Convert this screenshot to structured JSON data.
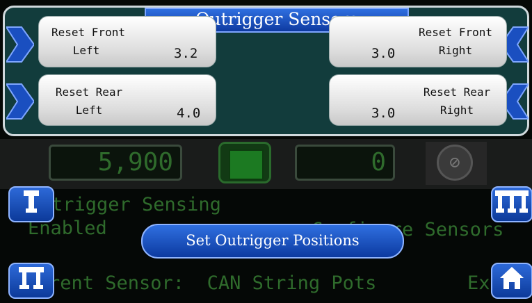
{
  "dialog": {
    "title": "Outrigger Sensors",
    "front_left": {
      "label": "Reset Front\nLeft",
      "value": "3.2"
    },
    "front_right": {
      "label": "Reset Front\nRight",
      "value": "3.0"
    },
    "rear_left": {
      "label": "Reset Rear\nLeft",
      "value": "4.0"
    },
    "rear_right": {
      "label": "Reset Rear\nRight",
      "value": "3.0"
    }
  },
  "background": {
    "field_left_value": "5,900",
    "field_right_value": "0",
    "sensing_line": "trigger Sensing",
    "enabled_line": "Enabled",
    "configure_line": "Configure Sensors",
    "current_sensor_line": "rent Sensor:  CAN String Pots",
    "exit_fragment": "Ex"
  },
  "set_positions_button": {
    "label": "Set Outrigger Positions"
  },
  "icons": {
    "arrows": "chevron-icon",
    "home": "home-icon",
    "outrigger": "outrigger-icon"
  },
  "colors": {
    "dialog_bg": "#123c3c",
    "button_blue": "#1a4fc0",
    "dim_green": "#2f6b2c"
  }
}
